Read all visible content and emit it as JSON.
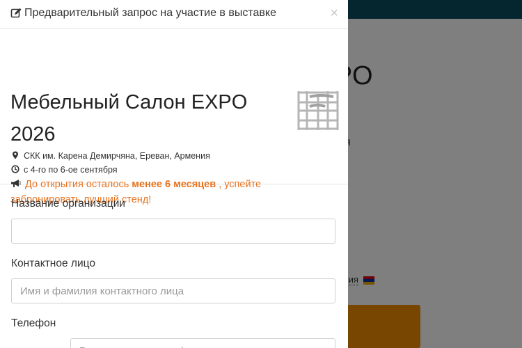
{
  "background": {
    "title_fragment": "EXPO",
    "subtitle_fragment": "я",
    "location_fragment": "рмения",
    "colors": {
      "topbar": "#0b4a5e",
      "button": "#f08c00"
    }
  },
  "modal": {
    "title": "Предварительный запрос на участие в выставке",
    "close_label": "×",
    "event": {
      "name": "Мебельный Салон EXPO 2026",
      "venue": "СКК им. Карена Демирчяна, Ереван, Армения",
      "dates": "с 4-го по 6-ое сентября",
      "promo_prefix": "До открытия осталось",
      "promo_highlight": "менее 6 месяцев",
      "promo_suffix": ", успейте забронировать лучший стенд!"
    },
    "form": {
      "organization": {
        "label": "Название организации",
        "value": "",
        "placeholder": ""
      },
      "contact": {
        "label": "Контактное лицо",
        "value": "",
        "placeholder": "Имя и фамилия контактного лица"
      },
      "phone": {
        "label": "Телефон",
        "value": "",
        "placeholder": "Введите номер телефона"
      }
    },
    "colors": {
      "promo": "#e8731f"
    },
    "icons": [
      "edit-icon",
      "close-icon",
      "map-marker-icon",
      "clock-icon",
      "megaphone-icon"
    ]
  }
}
